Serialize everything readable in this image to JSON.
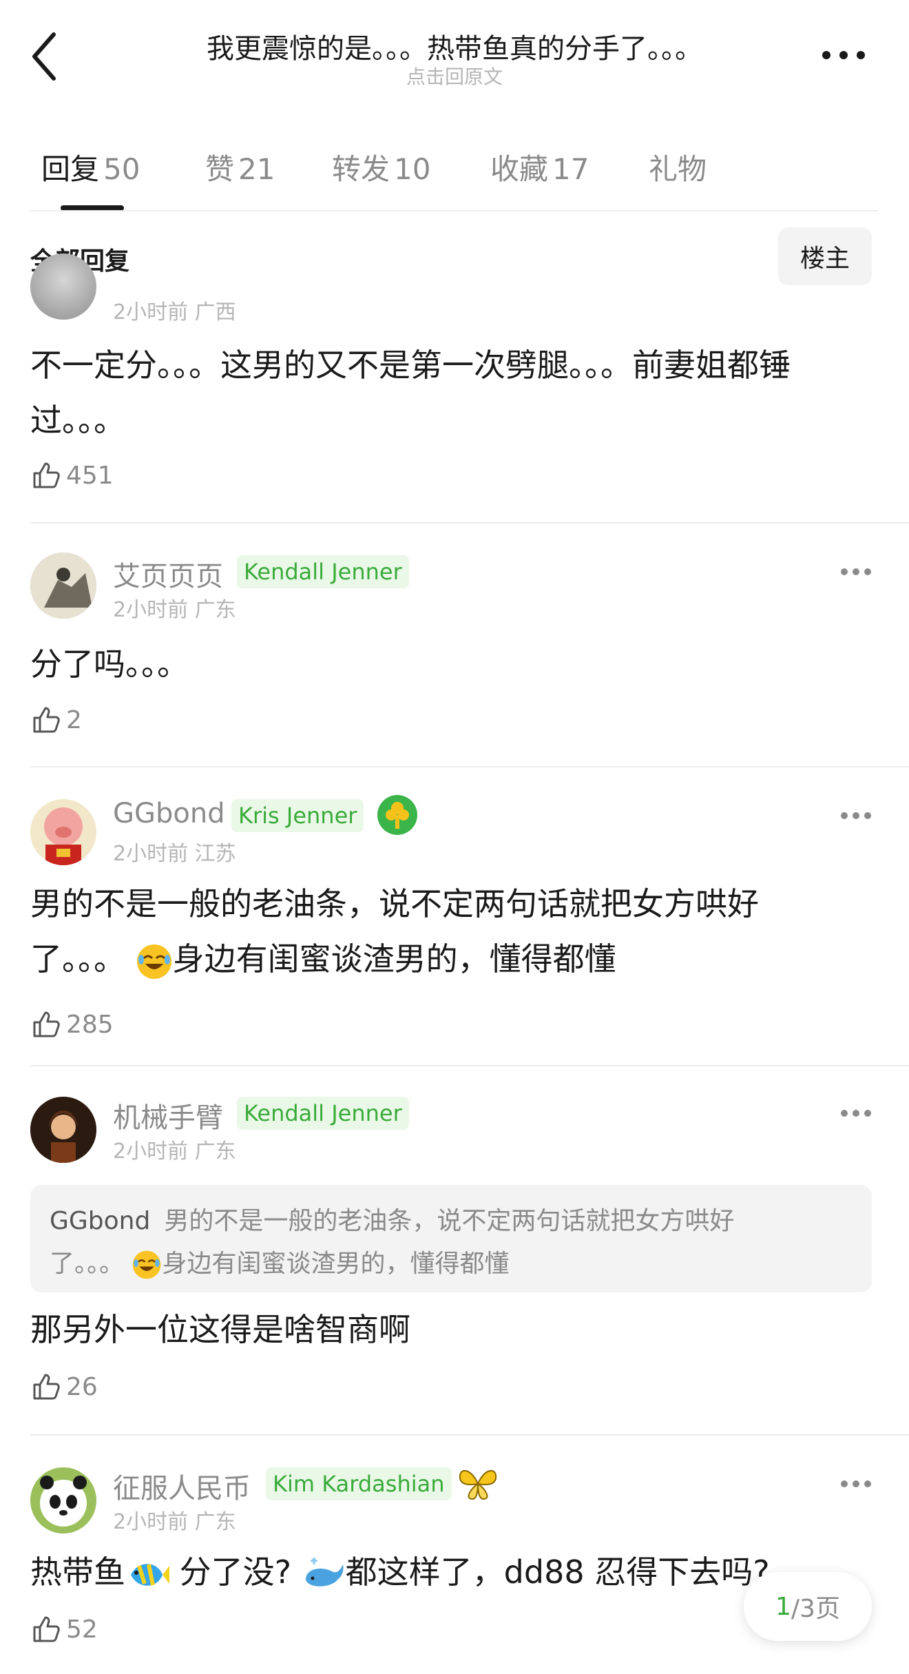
{
  "header": {
    "title": "我更震惊的是。。。热带鱼真的分手了。。。",
    "subtitle": "点击回原文"
  },
  "tabs": [
    {
      "label": "回复",
      "count": "50"
    },
    {
      "label": "赞",
      "count": "21"
    },
    {
      "label": "转发",
      "count": "10"
    },
    {
      "label": "收藏",
      "count": "17"
    },
    {
      "label": "礼物",
      "count": ""
    }
  ],
  "filter": {
    "label": "全部回复",
    "op_button": "楼主"
  },
  "comments": [
    {
      "meta": "2小时前 广西",
      "text": "不一定分。。。这男的又不是第一次劈腿。。。前妻姐都锤过。。。",
      "likes": "451"
    },
    {
      "user": "艾页页页",
      "tag": "Kendall Jenner",
      "meta": "2小时前 广东",
      "text": "分了吗。。。",
      "likes": "2"
    },
    {
      "user": "GGbond",
      "tag": "Kris Jenner",
      "meta": "2小时前 江苏",
      "text_line1": "男的不是一般的老油条，说不定两句话就把女方哄好",
      "text_line2a": "了。。。",
      "text_line2b": "身边有闺蜜谈渣男的，懂得都懂",
      "likes": "285"
    },
    {
      "user": "机械手臂",
      "tag": "Kendall Jenner",
      "meta": "2小时前 广东",
      "quote_user": "GGbond",
      "quote_line1": "男的不是一般的老油条，说不定两句话就把女方哄好",
      "quote_line2a": "了。。。",
      "quote_line2b": "身边有闺蜜谈渣男的，懂得都懂",
      "text": "那另外一位这得是啥智商啊",
      "likes": "26"
    },
    {
      "user": "征服人民币",
      "tag": "Kim Kardashian",
      "meta": "2小时前 广东",
      "text_a": "热带鱼",
      "text_b": "分了没?",
      "text_c": "都这样了，dd88 忍得下去吗?",
      "likes": "52"
    }
  ],
  "pager": {
    "current": "1",
    "rest": "/3页"
  },
  "colors": {
    "accent_green": "#3aab3a",
    "tag_bg": "#eaf8e8",
    "muted_text": "#8a8a8a"
  },
  "icons": [
    "back-chevron-icon",
    "more-dots-icon",
    "thumbs-up-icon",
    "laughing-emoji-icon",
    "tropical-fish-emoji-icon",
    "whale-emoji-icon",
    "butterfly-badge-icon",
    "flower-badge-icon"
  ]
}
